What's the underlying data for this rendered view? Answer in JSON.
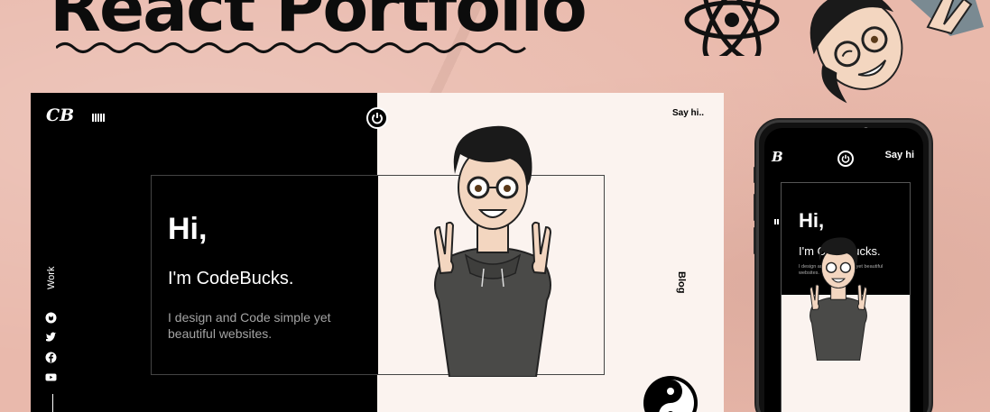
{
  "thumbnail": {
    "headline": "React Portfolio",
    "colors": {
      "paper": "#e8b5a7",
      "dark": "#000000",
      "light": "#fbf3ef",
      "hoodie": "#4a4a48"
    }
  },
  "desktop": {
    "logo": "CB",
    "say_hi": "Say hi..",
    "blog": "Blog",
    "work": "Work",
    "intro": {
      "greeting": "Hi,",
      "name": "I'm CodeBucks.",
      "description": "I design and Code simple yet beautiful websites."
    },
    "socials": [
      "github-icon",
      "twitter-icon",
      "facebook-icon",
      "youtube-icon"
    ]
  },
  "mobile": {
    "logo": "B",
    "say_hi": "Say hi",
    "intro": {
      "greeting": "Hi,",
      "name": "I'm CodeBucks.",
      "description": "I design and Code simple yet beautiful websites."
    }
  }
}
